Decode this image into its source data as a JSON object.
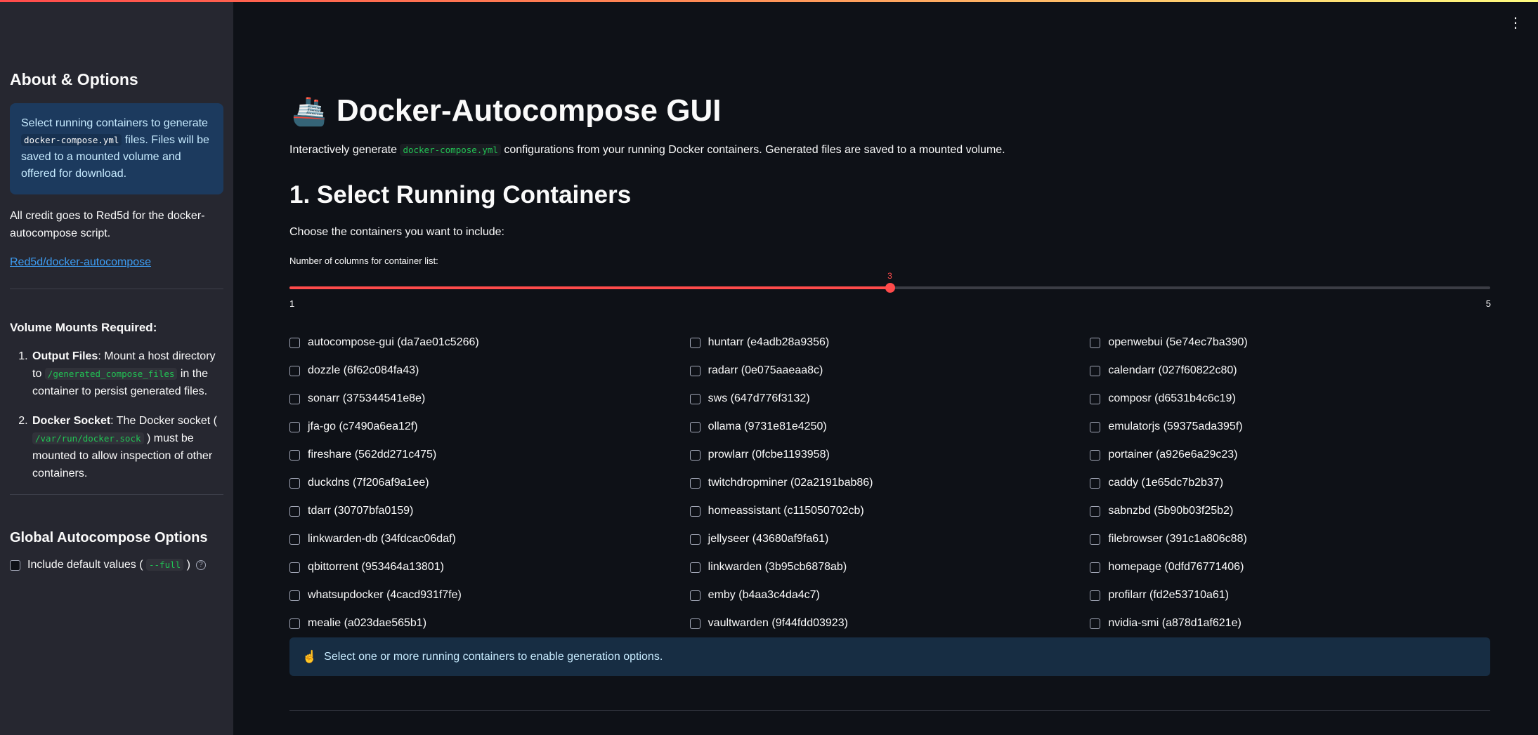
{
  "sidebar": {
    "about_title": "About & Options",
    "info_text_1": "Select running containers to generate",
    "info_code": "docker-compose.yml",
    "info_text_2": "files. Files will be saved to a mounted volume and offered for download.",
    "credit_text": "All credit goes to Red5d for the docker-autocompose script.",
    "link_text": "Red5d/docker-autocompose",
    "volume_title": "Volume Mounts Required:",
    "volume_items": [
      {
        "bold": "Output Files",
        "pre": ": Mount a host directory to",
        "code": "/generated_compose_files",
        "post": "in the container to persist generated files."
      },
      {
        "bold": "Docker Socket",
        "pre": ": The Docker socket (",
        "code": "/var/run/docker.sock",
        "post": ") must be mounted to allow inspection of other containers."
      }
    ],
    "options_title": "Global Autocompose Options",
    "option_label_pre": "Include default values (",
    "option_code": "--full",
    "option_label_post": ")",
    "help_glyph": "?"
  },
  "header": {
    "menu_icon": "⋮"
  },
  "main": {
    "title_icon": "🚢",
    "title": "Docker-Autocompose GUI",
    "subtitle_pre": "Interactively generate",
    "subtitle_code": "docker-compose.yml",
    "subtitle_post": "configurations from your running Docker containers. Generated files are saved to a mounted volume.",
    "section_title": "1. Select Running Containers",
    "choose_text": "Choose the containers you want to include:",
    "slider": {
      "label": "Number of columns for container list:",
      "min": 1,
      "max": 5,
      "value": 3,
      "min_label": "1",
      "max_label": "5",
      "value_label": "3"
    },
    "columns": [
      [
        "autocompose-gui (da7ae01c5266)",
        "dozzle (6f62c084fa43)",
        "sonarr (375344541e8e)",
        "jfa-go (c7490a6ea12f)",
        "fireshare (562dd271c475)",
        "duckdns (7f206af9a1ee)",
        "tdarr (30707bfa0159)",
        "linkwarden-db (34fdcac06daf)",
        "qbittorrent (953464a13801)",
        "whatsupdocker (4cacd931f7fe)",
        "mealie (a023dae565b1)"
      ],
      [
        "huntarr (e4adb28a9356)",
        "radarr (0e075aaeaa8c)",
        "sws (647d776f3132)",
        "ollama (9731e81e4250)",
        "prowlarr (0fcbe1193958)",
        "twitchdropminer (02a2191bab86)",
        "homeassistant (c115050702cb)",
        "jellyseer (43680af9fa61)",
        "linkwarden (3b95cb6878ab)",
        "emby (b4aa3c4da4c7)",
        "vaultwarden (9f44fdd03923)"
      ],
      [
        "openwebui (5e74ec7ba390)",
        "calendarr (027f60822c80)",
        "composr (d6531b4c6c19)",
        "emulatorjs (59375ada395f)",
        "portainer (a926e6a29c23)",
        "caddy (1e65dc7b2b37)",
        "sabnzbd (5b90b03f25b2)",
        "filebrowser (391c1a806c88)",
        "homepage (0dfd76771406)",
        "profilarr (fd2e53710a61)",
        "nvidia-smi (a878d1af621e)"
      ]
    ],
    "notice_icon": "☝️",
    "notice_text": "Select one or more running containers to enable generation options."
  },
  "colors": {
    "accent": "#ff4b4b",
    "background": "#0e1117",
    "sidebar": "#262730",
    "info": "#1c3a5e"
  }
}
